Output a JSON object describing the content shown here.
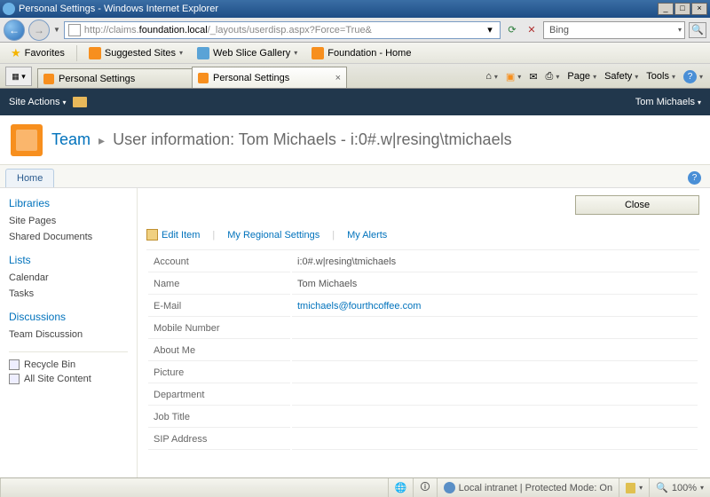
{
  "window": {
    "title": "Personal Settings - Windows Internet Explorer"
  },
  "nav": {
    "url_host": "http://claims.",
    "url_bold": "foundation.local",
    "url_rest": "/_layouts/userdisp.aspx?Force=True&",
    "search_engine": "Bing"
  },
  "favbar": {
    "favorites": "Favorites",
    "suggested": "Suggested Sites",
    "slice": "Web Slice Gallery",
    "foundation": "Foundation - Home"
  },
  "tabs": [
    {
      "label": "Personal Settings"
    },
    {
      "label": "Personal Settings"
    }
  ],
  "ie_menu": {
    "page": "Page",
    "safety": "Safety",
    "tools": "Tools"
  },
  "sp": {
    "site_actions": "Site Actions",
    "user": "Tom Michaels",
    "team_link": "Team",
    "page_title": "User information: Tom Michaels - i:0#.w|resing\\tmichaels",
    "home_tab": "Home"
  },
  "sidebar": {
    "libraries_h": "Libraries",
    "libraries": [
      "Site Pages",
      "Shared Documents"
    ],
    "lists_h": "Lists",
    "lists": [
      "Calendar",
      "Tasks"
    ],
    "discussions_h": "Discussions",
    "discussions": [
      "Team Discussion"
    ],
    "recycle": "Recycle Bin",
    "allcontent": "All Site Content"
  },
  "main": {
    "close": "Close",
    "edit_item": "Edit Item",
    "regional": "My Regional Settings",
    "alerts": "My Alerts",
    "fields": [
      {
        "label": "Account",
        "value": "i:0#.w|resing\\tmichaels"
      },
      {
        "label": "Name",
        "value": "Tom Michaels"
      },
      {
        "label": "E-Mail",
        "value": "tmichaels@fourthcoffee.com",
        "link": true
      },
      {
        "label": "Mobile Number",
        "value": ""
      },
      {
        "label": "About Me",
        "value": ""
      },
      {
        "label": "Picture",
        "value": ""
      },
      {
        "label": "Department",
        "value": ""
      },
      {
        "label": "Job Title",
        "value": ""
      },
      {
        "label": "SIP Address",
        "value": ""
      }
    ]
  },
  "status": {
    "zone": "Local intranet | Protected Mode: On",
    "zoom": "100%"
  }
}
